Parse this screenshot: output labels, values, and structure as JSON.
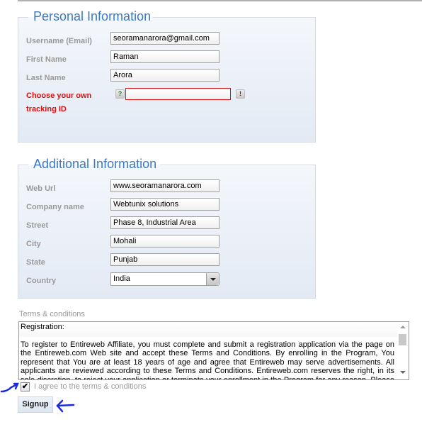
{
  "personal": {
    "legend": "Personal Information",
    "fields": {
      "username": {
        "label": "Username (Email)",
        "value": "seoramanarora@gmail.com"
      },
      "first_name": {
        "label": "First Name",
        "value": "Raman"
      },
      "last_name": {
        "label": "Last Name",
        "value": "Arora"
      },
      "tracking_id": {
        "label_line1": "Choose your own",
        "label_line2": "tracking ID",
        "value": ""
      }
    },
    "help_icon": "?",
    "error_icon": "!"
  },
  "additional": {
    "legend": "Additional Information",
    "fields": {
      "web_url": {
        "label": "Web Url",
        "value": "www.seoramanarora.com"
      },
      "company": {
        "label": "Company name",
        "value": "Webtunix solutions"
      },
      "street": {
        "label": "Street",
        "value": "Phase 8, Industrial Area"
      },
      "city": {
        "label": "City",
        "value": "Mohali"
      },
      "state": {
        "label": "State",
        "value": "Punjab"
      },
      "country": {
        "label": "Country",
        "value": "India"
      }
    }
  },
  "terms": {
    "label": "Terms & conditions",
    "heading": "Registration:",
    "body": "To register to Entireweb Affiliate, you must complete and submit a registration application via the page on the Entireweb.com Web site and accept these Terms and Conditions. By enrolling in the Program, You represent that You are at least 18 years of age and agree that Entireweb may serve advertisements. All applicants are reviewed according to these Terms and Conditions. Entireweb.com reserves the right, in its sole discretion, to reject your application or terminate your enrollment in the Program for any reason. Please note that we may"
  },
  "agree": {
    "label": "I agree to the terms & conditions",
    "checked": true,
    "check_glyph": "✔"
  },
  "signup_label": "Signup",
  "colors": {
    "legend": "#3b7ac2",
    "error": "#dd1111",
    "annotation": "#1a2adf"
  }
}
